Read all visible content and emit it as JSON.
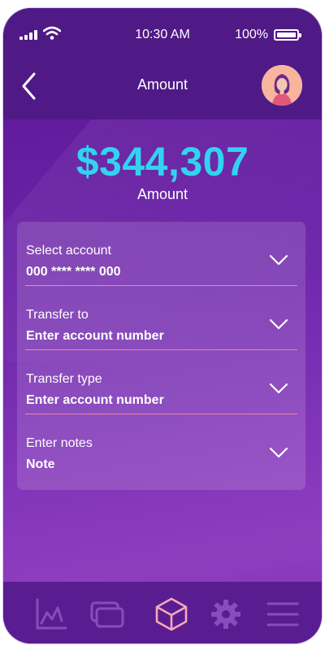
{
  "status": {
    "time": "10:30 AM",
    "battery": "100%"
  },
  "header": {
    "title": "Amount"
  },
  "balance": {
    "value": "$344,307",
    "label": "Amount"
  },
  "form": {
    "fields": [
      {
        "label": "Select account",
        "value": "000 **** **** 000"
      },
      {
        "label": "Transfer to",
        "value": "Enter account number"
      },
      {
        "label": "Transfer type",
        "value": "Enter account number"
      },
      {
        "label": "Enter notes",
        "value": "Note"
      }
    ]
  },
  "nav": {
    "items": [
      {
        "icon": "chart-icon"
      },
      {
        "icon": "cards-icon"
      },
      {
        "icon": "cube-icon",
        "active": true
      },
      {
        "icon": "gear-icon"
      },
      {
        "icon": "menu-icon"
      }
    ]
  },
  "colors": {
    "accent": "#32d3f0",
    "divider": "#f2879b",
    "active_icon": "#f5a9b8",
    "inactive_icon": "#8a4bbd"
  }
}
